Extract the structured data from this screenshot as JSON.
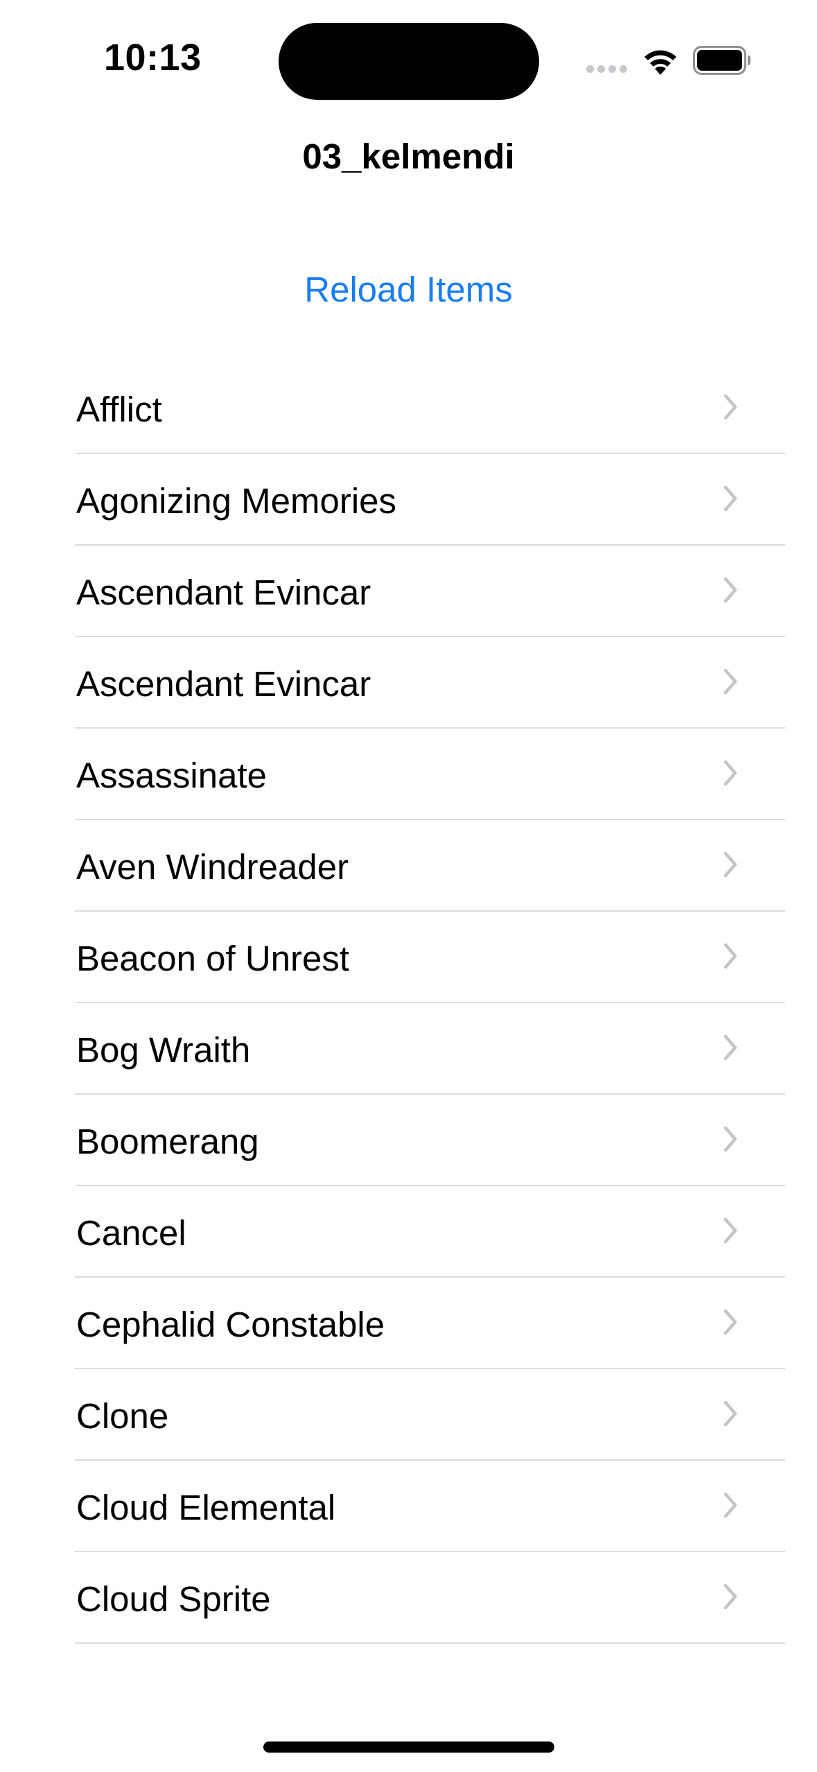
{
  "status_bar": {
    "time": "10:13"
  },
  "nav": {
    "title": "03_kelmendi"
  },
  "reload_button": {
    "label": "Reload Items"
  },
  "items": [
    {
      "label": "Afflict"
    },
    {
      "label": "Agonizing Memories"
    },
    {
      "label": "Ascendant Evincar"
    },
    {
      "label": "Ascendant Evincar"
    },
    {
      "label": "Assassinate"
    },
    {
      "label": "Aven Windreader"
    },
    {
      "label": "Beacon of Unrest"
    },
    {
      "label": "Bog Wraith"
    },
    {
      "label": "Boomerang"
    },
    {
      "label": "Cancel"
    },
    {
      "label": "Cephalid Constable"
    },
    {
      "label": "Clone"
    },
    {
      "label": "Cloud Elemental"
    },
    {
      "label": "Cloud Sprite"
    }
  ],
  "icons": {
    "row_accessory": "chevron-right-icon",
    "signal": "cellular-signal-icon",
    "wifi": "wifi-icon",
    "battery": "battery-icon"
  },
  "colors": {
    "accent": "#1a7cf0",
    "separator": "#dcdcdf",
    "chevron": "#c4c4c7"
  }
}
